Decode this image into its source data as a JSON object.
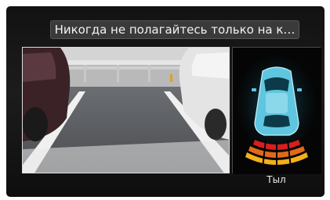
{
  "banner": {
    "text": "Никогда не полагайтесь только на к…"
  },
  "camera_view": {
    "description_icon": "rear-camera-feed"
  },
  "sensor_display": {
    "label": "Тыл",
    "car_icon": "car-top-view-icon",
    "arc_colors": [
      "#d81e1e",
      "#e06a1a",
      "#f3b019"
    ]
  }
}
